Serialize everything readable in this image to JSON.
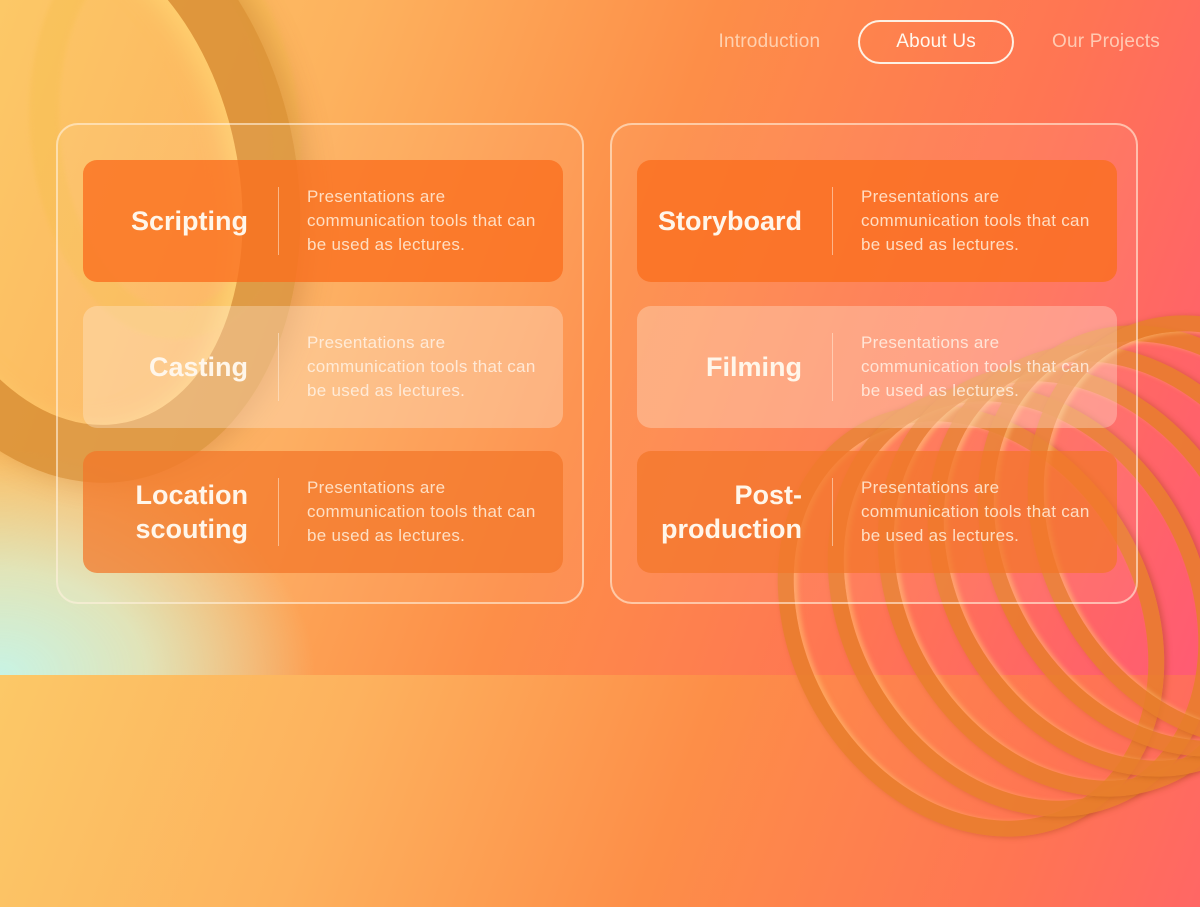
{
  "nav": {
    "items": [
      {
        "label": "Introduction",
        "active": false
      },
      {
        "label": "About Us",
        "active": true
      },
      {
        "label": "Our Projects",
        "active": false
      }
    ]
  },
  "panels": [
    {
      "cards": [
        {
          "title": "Scripting",
          "description": "Presentations are communication tools that can be used as lectures."
        },
        {
          "title": "Casting",
          "description": "Presentations are communication tools that can be used as lectures."
        },
        {
          "title": "Location\nscouting",
          "description": "Presentations are communication tools that can be used as lectures."
        }
      ]
    },
    {
      "cards": [
        {
          "title": "Storyboard",
          "description": "Presentations are communication tools that can be used as lectures."
        },
        {
          "title": "Filming",
          "description": "Presentations are communication tools that can be used as lectures."
        },
        {
          "title": "Post-\nproduction",
          "description": "Presentations are communication tools that can be used as lectures."
        }
      ]
    }
  ],
  "colors": {
    "gradient_start": "#fcc867",
    "gradient_mid": "#fd8e48",
    "gradient_end": "#ff5b73",
    "corner_mint": "#c8f3e4",
    "card_strong": "#fa6e1e",
    "text_light": "#fff6ea"
  }
}
